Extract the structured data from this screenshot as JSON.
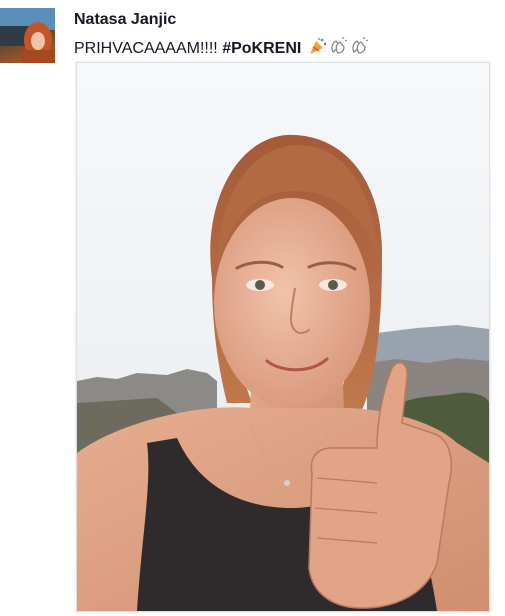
{
  "post": {
    "author_name": "Natasa Janjic",
    "text": "PRIHVACAAAAM!!!! ",
    "hashtag": "#PoKRENI",
    "emoji_icons": [
      "party-popper-icon",
      "clapping-hands-icon",
      "clapping-hands-icon"
    ]
  },
  "photo": {
    "subject": "selfie-thumbs-up",
    "colors": {
      "sky": "#f4f6f8",
      "hair": "#b0653f",
      "skin": "#e9b49b",
      "tank_top": "#2f2b2d",
      "trees": "#4d5a3a"
    }
  }
}
